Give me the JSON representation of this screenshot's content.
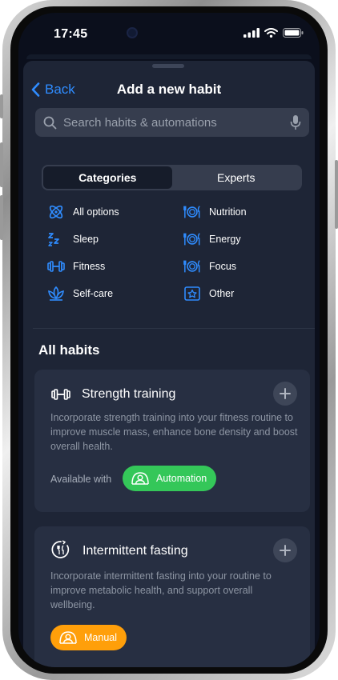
{
  "status_bar": {
    "time": "17:45"
  },
  "nav": {
    "back_label": "Back",
    "title": "Add a new habit"
  },
  "search": {
    "placeholder": "Search habits & automations"
  },
  "segmented": {
    "options": [
      "Categories",
      "Experts"
    ],
    "selected": "Categories"
  },
  "categories": [
    {
      "label": "All options",
      "icon": "atom-icon"
    },
    {
      "label": "Nutrition",
      "icon": "plate-icon"
    },
    {
      "label": "Sleep",
      "icon": "sleep-icon"
    },
    {
      "label": "Energy",
      "icon": "plate-icon"
    },
    {
      "label": "Fitness",
      "icon": "dumbbell-icon"
    },
    {
      "label": "Focus",
      "icon": "plate-icon"
    },
    {
      "label": "Self-care",
      "icon": "lotus-icon"
    },
    {
      "label": "Other",
      "icon": "star-box-icon"
    }
  ],
  "section": {
    "title": "All habits"
  },
  "habits": [
    {
      "title": "Strength training",
      "icon": "dumbbell-icon",
      "description": "Incorporate strength training into your fitness routine to improve muscle mass, enhance bone density and boost overall health.",
      "available_label": "Available with",
      "badge": "Automation",
      "badge_color": "#34c759"
    },
    {
      "title": "Intermittent fasting",
      "icon": "fasting-clock-icon",
      "description": "Incorporate intermittent fasting into your routine to improve metabolic health, and support overall wellbeing.",
      "badge": "Manual",
      "badge_color": "#ff9f0a"
    }
  ],
  "colors": {
    "accent": "#2f8cff",
    "sheet": "#1e2536",
    "card": "#272f42"
  }
}
